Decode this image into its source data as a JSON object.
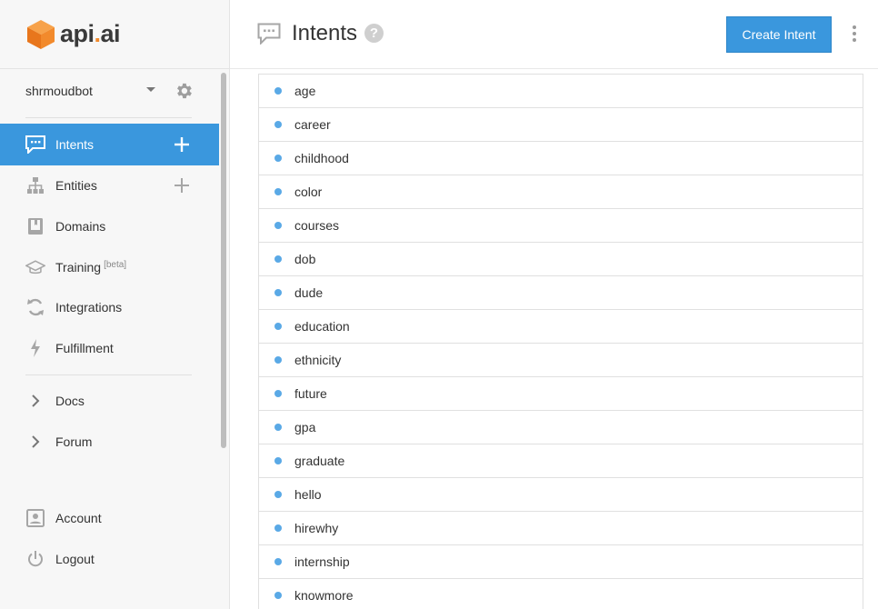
{
  "logo": {
    "text_main": "api",
    "text_dot": ".",
    "text_tail": "ai",
    "brand_color": "#f28a2c"
  },
  "agent": {
    "name": "shrmoudbot"
  },
  "nav": {
    "intents": "Intents",
    "entities": "Entities",
    "domains": "Domains",
    "training": "Training",
    "training_badge": "[beta]",
    "integrations": "Integrations",
    "fulfillment": "Fulfillment",
    "docs": "Docs",
    "forum": "Forum",
    "account": "Account",
    "logout": "Logout"
  },
  "header": {
    "title": "Intents",
    "help": "?",
    "create_button": "Create Intent"
  },
  "intents": [
    "age",
    "career",
    "childhood",
    "color",
    "courses",
    "dob",
    "dude",
    "education",
    "ethnicity",
    "future",
    "gpa",
    "graduate",
    "hello",
    "hirewhy",
    "internship",
    "knowmore"
  ],
  "colors": {
    "accent": "#3a97dd",
    "dot": "#5aa9e6",
    "sidebar_bg": "#f7f7f7"
  }
}
